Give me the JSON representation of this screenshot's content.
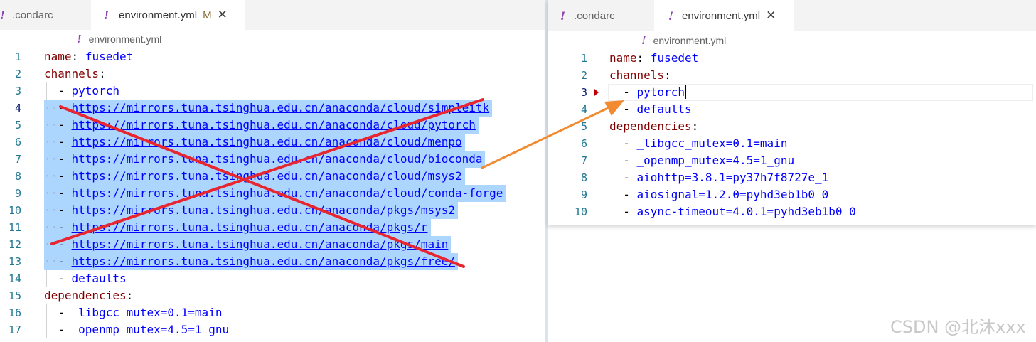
{
  "left": {
    "tabs": [
      {
        "icon": "!",
        "label": ".condarc",
        "active": false
      },
      {
        "icon": "!",
        "label": "environment.yml",
        "modified": "M",
        "active": true
      }
    ],
    "breadcrumb": {
      "icon": "!",
      "label": "environment.yml"
    },
    "lines": [
      {
        "n": "1",
        "key": "name",
        "value": "fusedet"
      },
      {
        "n": "2",
        "key": "channels"
      },
      {
        "n": "3",
        "item": "pytorch"
      },
      {
        "n": "4",
        "url": "https://mirrors.tuna.tsinghua.edu.cn/anaconda/cloud/simpleitk"
      },
      {
        "n": "5",
        "url": "https://mirrors.tuna.tsinghua.edu.cn/anaconda/cloud/pytorch"
      },
      {
        "n": "6",
        "url": "https://mirrors.tuna.tsinghua.edu.cn/anaconda/cloud/menpo"
      },
      {
        "n": "7",
        "url": "https://mirrors.tuna.tsinghua.edu.cn/anaconda/cloud/bioconda"
      },
      {
        "n": "8",
        "url": "https://mirrors.tuna.tsinghua.edu.cn/anaconda/cloud/msys2"
      },
      {
        "n": "9",
        "url": "https://mirrors.tuna.tsinghua.edu.cn/anaconda/cloud/conda-forge"
      },
      {
        "n": "10",
        "url": "https://mirrors.tuna.tsinghua.edu.cn/anaconda/pkgs/msys2"
      },
      {
        "n": "11",
        "url": "https://mirrors.tuna.tsinghua.edu.cn/anaconda/pkgs/r"
      },
      {
        "n": "12",
        "url": "https://mirrors.tuna.tsinghua.edu.cn/anaconda/pkgs/main"
      },
      {
        "n": "13",
        "url": "https://mirrors.tuna.tsinghua.edu.cn/anaconda/pkgs/free/"
      },
      {
        "n": "14",
        "item": "defaults"
      },
      {
        "n": "15",
        "key": "dependencies"
      },
      {
        "n": "16",
        "item": "_libgcc_mutex=0.1=main"
      },
      {
        "n": "17",
        "item": "_openmp_mutex=4.5=1_gnu"
      }
    ]
  },
  "right": {
    "tabs": [
      {
        "icon": "!",
        "label": ".condarc",
        "active": false
      },
      {
        "icon": "!",
        "label": "environment.yml",
        "active": true
      }
    ],
    "breadcrumb": {
      "icon": "!",
      "label": "environment.yml"
    },
    "lines": [
      {
        "n": "1",
        "key": "name",
        "value": "fusedet"
      },
      {
        "n": "2",
        "key": "channels"
      },
      {
        "n": "3",
        "item": "pytorch"
      },
      {
        "n": "4",
        "item": "defaults"
      },
      {
        "n": "5",
        "key": "dependencies"
      },
      {
        "n": "6",
        "item": "_libgcc_mutex=0.1=main"
      },
      {
        "n": "7",
        "item": "_openmp_mutex=4.5=1_gnu"
      },
      {
        "n": "8",
        "item": "aiohttp=3.8.1=py37h7f8727e_1"
      },
      {
        "n": "9",
        "item": "aiosignal=1.2.0=pyhd3eb1b0_0"
      },
      {
        "n": "10",
        "item": "async-timeout=4.0.1=pyhd3eb1b0_0"
      }
    ]
  },
  "annotation": {
    "cross_color": "#e8262f",
    "arrow_color": "#f28a30"
  },
  "watermark": "CSDN @北沐xxx"
}
